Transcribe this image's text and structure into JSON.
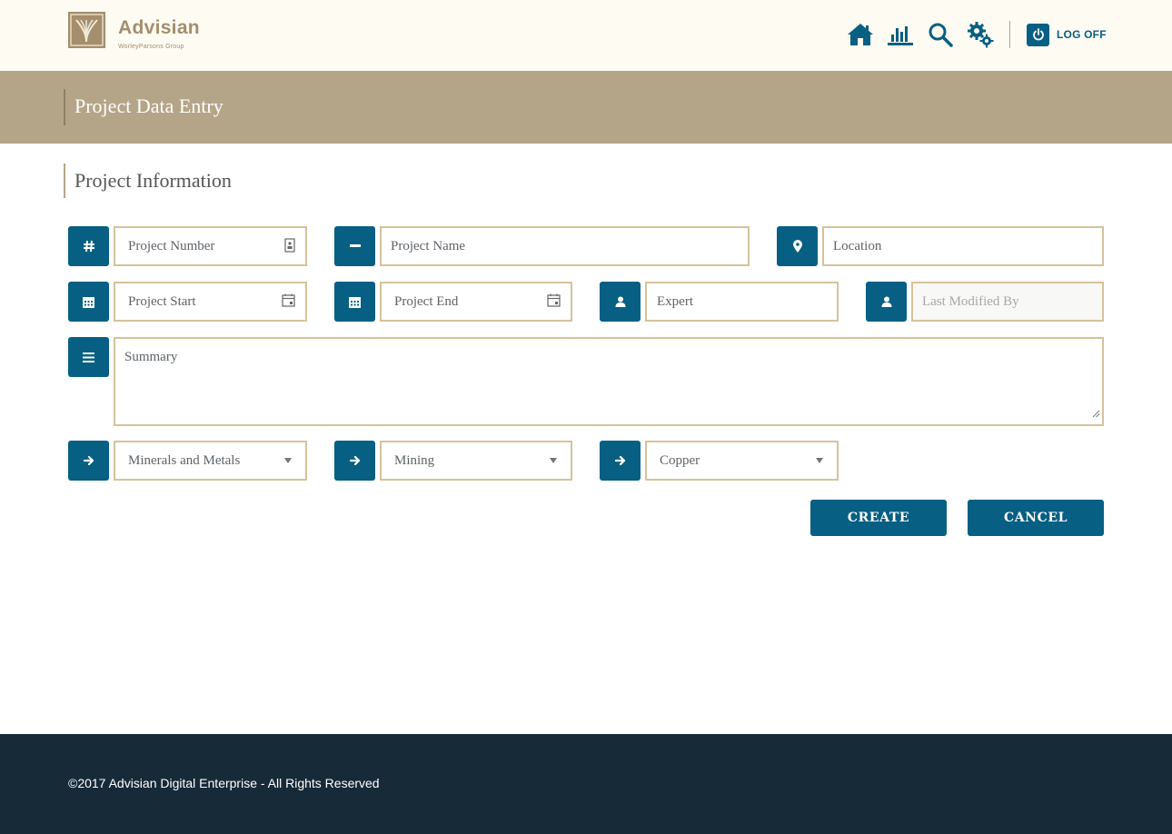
{
  "header": {
    "brand_name": "Advisian",
    "brand_sub": "WorleyParsons Group",
    "nav": [
      {
        "icon": "home-icon",
        "label": ""
      },
      {
        "icon": "bar-chart-icon",
        "label": ""
      },
      {
        "icon": "search-icon",
        "label": ""
      },
      {
        "icon": "gears-icon",
        "label": ""
      }
    ],
    "logoff_label": "LOG OFF"
  },
  "page": {
    "title": "Project Data Entry"
  },
  "section": {
    "title": "Project Information"
  },
  "form": {
    "project_number": {
      "icon": "hash-icon",
      "placeholder": "Project Number"
    },
    "project_name": {
      "icon": "minus-icon",
      "placeholder": "Project Name"
    },
    "location": {
      "icon": "map-marker-icon",
      "placeholder": "Location"
    },
    "project_start": {
      "icon": "calendar-icon",
      "placeholder": "Project Start"
    },
    "project_end": {
      "icon": "calendar-icon",
      "placeholder": "Project End"
    },
    "expert": {
      "icon": "user-icon",
      "placeholder": "Expert"
    },
    "last_modified_by": {
      "icon": "user-icon",
      "placeholder": "Last Modified By"
    },
    "summary": {
      "icon": "menu-lines-icon",
      "placeholder": "Summary"
    },
    "sector": {
      "icon": "arrow-right-icon",
      "value": "Minerals and Metals"
    },
    "subsector": {
      "icon": "arrow-right-icon",
      "value": "Mining"
    },
    "commodity": {
      "icon": "arrow-right-icon",
      "value": "Copper"
    }
  },
  "actions": {
    "create_label": "CREATE",
    "cancel_label": "CANCEL"
  },
  "footer": {
    "copyright": "©2017 Advisian Digital Enterprise - All Rights Reserved"
  },
  "colors": {
    "primary": "#075f83",
    "gold": "#b5a588",
    "border": "#d6c29b",
    "header_bg": "#fdfbf2",
    "footer_bg": "#172a38"
  }
}
